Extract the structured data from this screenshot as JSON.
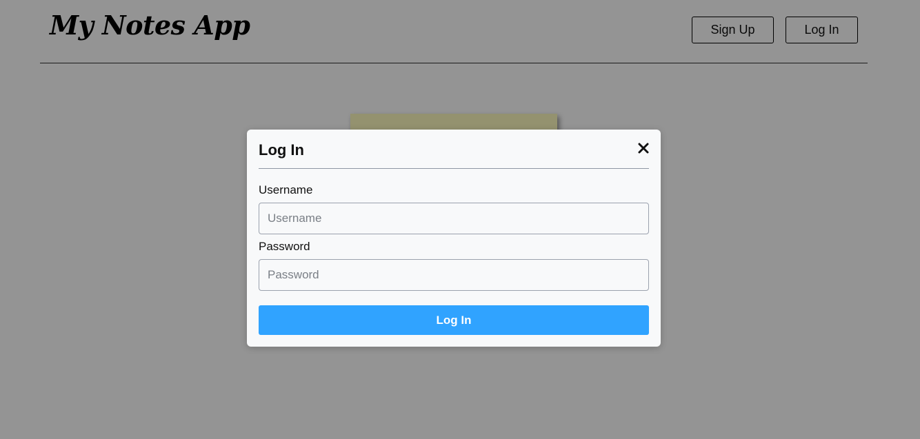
{
  "header": {
    "brand": "My Notes App",
    "signup_label": "Sign Up",
    "login_label": "Log In"
  },
  "modal": {
    "title": "Log In",
    "close_icon": "close-icon",
    "username_label": "Username",
    "username_placeholder": "Username",
    "username_value": "",
    "password_label": "Password",
    "password_placeholder": "Password",
    "password_value": "",
    "submit_label": "Log In"
  },
  "colors": {
    "note_card": "#fffcbf",
    "primary_button": "#30a3ff",
    "overlay": "rgba(0,0,0,0.42)"
  }
}
